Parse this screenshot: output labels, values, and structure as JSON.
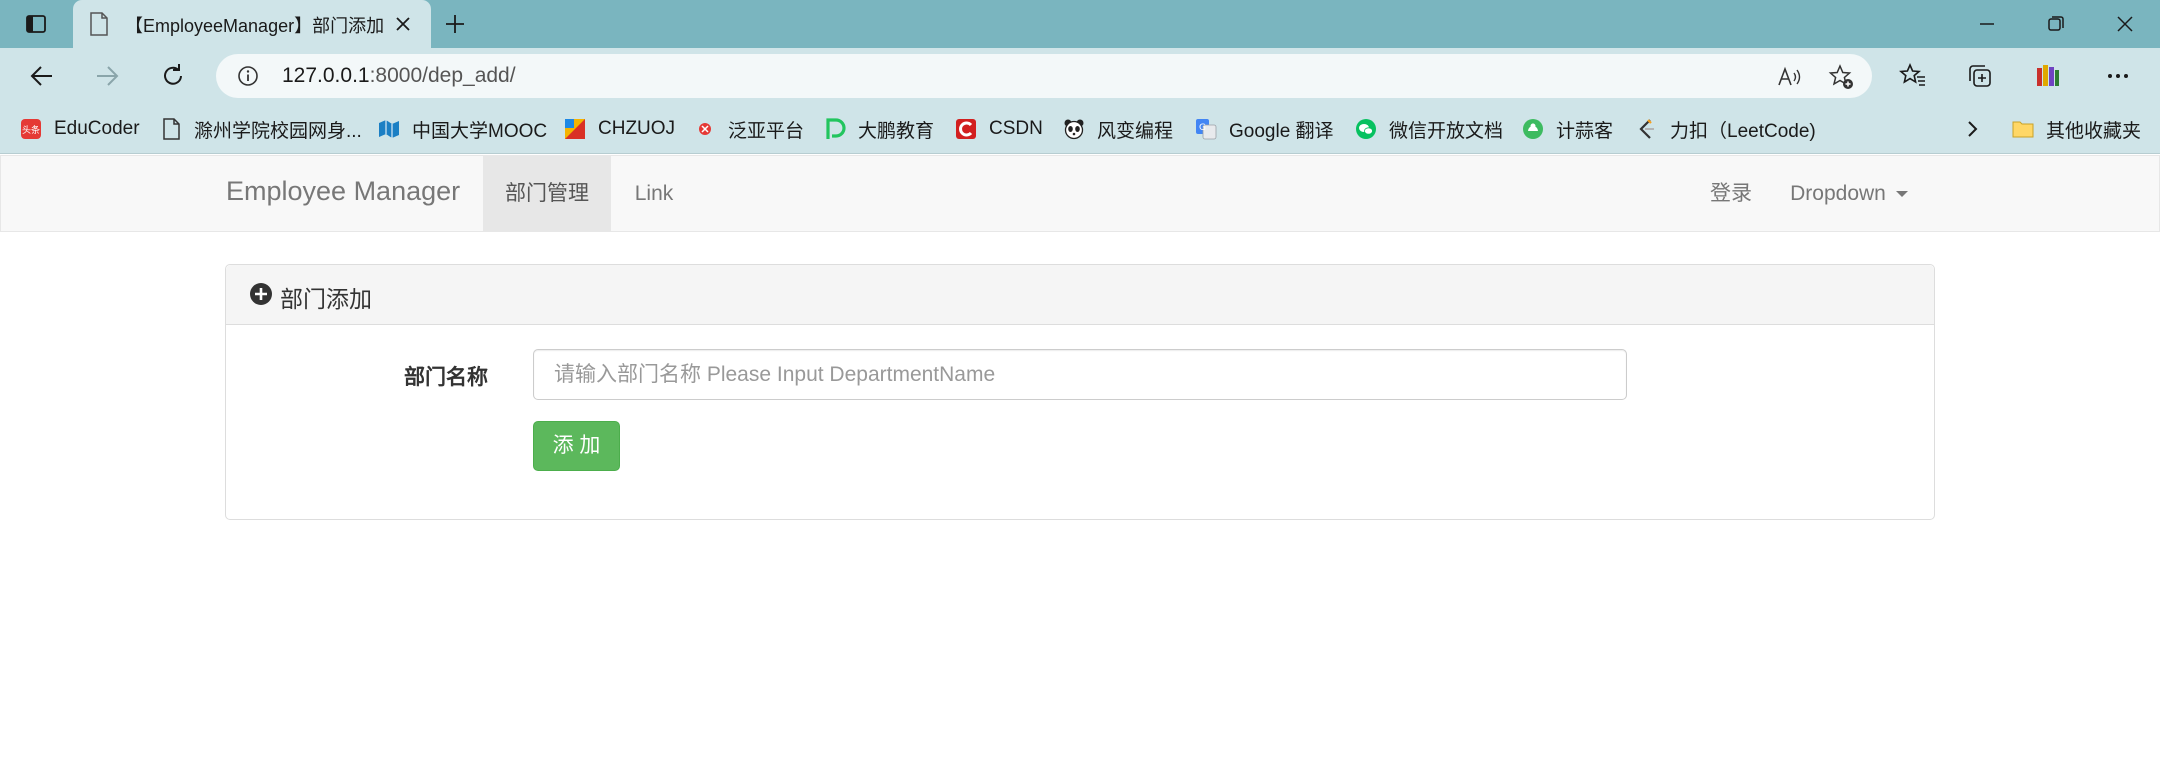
{
  "browser": {
    "tab_title": "【EmployeeManager】部门添加",
    "url_host": "127.0.0.1",
    "url_path": ":8000/dep_add/",
    "bookmarks": [
      {
        "label": "EduCoder",
        "icon": "toutiao-icon"
      },
      {
        "label": "滁州学院校园网身...",
        "icon": "page-icon"
      },
      {
        "label": "中国大学MOOC",
        "icon": "mooc-icon"
      },
      {
        "label": "CHZUOJ",
        "icon": "chzuoj-icon"
      },
      {
        "label": "泛亚平台",
        "icon": "fanya-icon"
      },
      {
        "label": "大鹏教育",
        "icon": "dapeng-icon"
      },
      {
        "label": "CSDN",
        "icon": "csdn-icon"
      },
      {
        "label": "风变编程",
        "icon": "panda-icon"
      },
      {
        "label": "Google 翻译",
        "icon": "google-translate-icon"
      },
      {
        "label": "微信开放文档",
        "icon": "wechat-icon"
      },
      {
        "label": "计蒜客",
        "icon": "jisuanke-icon"
      },
      {
        "label": "力扣（LeetCode)",
        "icon": "leetcode-icon"
      }
    ],
    "other_bookmarks": "其他收藏夹",
    "colors": {
      "titlebar": "#7ab5bf",
      "toolbar": "#cfe4e8"
    }
  },
  "navbar": {
    "brand": "Employee Manager",
    "items": [
      {
        "label": "部门管理",
        "active": true
      },
      {
        "label": "Link",
        "active": false
      }
    ],
    "login": "登录",
    "dropdown": "Dropdown"
  },
  "panel": {
    "title": "部门添加",
    "field_label": "部门名称",
    "input_placeholder": "请输入部门名称 Please Input DepartmentName",
    "input_value": "",
    "submit_label": "添 加",
    "colors": {
      "button": "#5cb85c"
    }
  }
}
